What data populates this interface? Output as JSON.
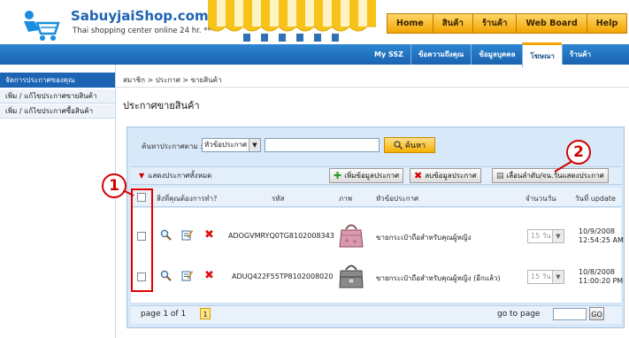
{
  "brand": {
    "name": "SabuyjaiShop.com",
    "registered": "®",
    "tagline": "Thai shopping center online 24 hr.",
    "tagline_mark": "***"
  },
  "top_nav": [
    "Home",
    "สินค้า",
    "ร้านค้า",
    "Web Board",
    "Help"
  ],
  "sub_nav": [
    {
      "label": "My SSZ",
      "active": false
    },
    {
      "label": "ข้อความถึงคุณ",
      "active": false
    },
    {
      "label": "ข้อมูลบุคคล",
      "active": false
    },
    {
      "label": "โฆษณา",
      "active": true
    },
    {
      "label": "ร้านค้า",
      "active": false
    }
  ],
  "sidebar": {
    "heading": "จัดการประกาศของคุณ",
    "items": [
      "เพิ่ม / แก้ไขประกาศขายสินค้า",
      "เพิ่ม / แก้ไขประกาศซื้อสินค้า"
    ]
  },
  "breadcrumb": "สมาชิก > ประกาศ > ขายสินค้า",
  "page_title": "ประกาศขายสินค้า",
  "search": {
    "label": "ค้นหาประกาศตาม :",
    "field_value": "หัวข้อประกาศ",
    "button": "ค้นหา"
  },
  "toolbar": {
    "show_all": "แสดงประกาศทั้งหมด",
    "add_button": "เพิ่มข้อมูลประกาศ",
    "delete_button": "ลบข้อมูลประกาศ",
    "reorder_button": "เลื่อนลำดับ/จน.วันแสดงประกาศ"
  },
  "table": {
    "columns": [
      "สิ่งที่คุณต้องการทำ?",
      "รหัส",
      "ภาพ",
      "หัวข้อประกาศ",
      "จำนวนวัน",
      "วันที่ update"
    ],
    "rows": [
      {
        "code": "ADOGVMRYQ0TG8102008343",
        "title": "ขายกระเป๋าถือสำหรับคุณผู้หญิง",
        "days": "15 วัน",
        "date": "10/9/2008",
        "time": "12:54:25 AM"
      },
      {
        "code": "ADUQ422F55TP8102008020",
        "title": "ขายกระเป๋าถือสำหรับคุณผู้หญิง (อีกแล้ว)",
        "days": "15 วัน",
        "date": "10/8/2008",
        "time": "11:00:20 PM"
      }
    ]
  },
  "pagination": {
    "info": "page 1 of 1",
    "current": "1",
    "goto_label": "go to page",
    "goto_button": "GO"
  },
  "callouts": [
    "1",
    "2"
  ],
  "colors": {
    "brand_blue": "#1c64b4",
    "accent_orange": "#f3a600",
    "panel_bg": "#d7e8f8",
    "callout_red": "#d40000"
  }
}
